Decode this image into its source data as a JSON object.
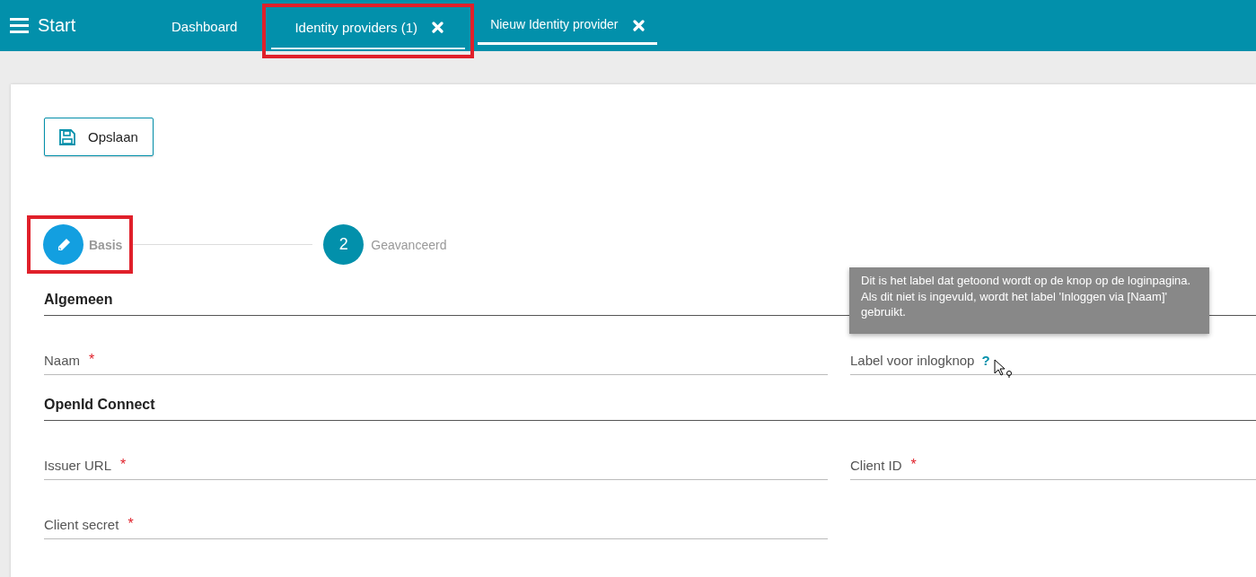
{
  "topbar": {
    "title": "Start"
  },
  "tabs": [
    {
      "label": "Dashboard",
      "selected": false,
      "closable": false,
      "highlighted": false,
      "hovered": false
    },
    {
      "label": "Identity providers (1)",
      "selected": false,
      "closable": true,
      "highlighted": true,
      "hovered": true
    },
    {
      "label": "Nieuw Identity provider",
      "selected": true,
      "closable": true,
      "highlighted": false,
      "hovered": false
    }
  ],
  "save_button": {
    "label": "Opslaan"
  },
  "steps": [
    {
      "label": "Basis",
      "selected": true,
      "highlighted": true
    },
    {
      "label": "Geavanceerd",
      "number": "2",
      "selected": false,
      "highlighted": false
    }
  ],
  "sections": [
    {
      "title": "Algemeen",
      "fields": [
        {
          "label": "Naam",
          "required_mark": "*"
        },
        {
          "label": "Label voor inlogknop",
          "help_mark": "?"
        }
      ]
    },
    {
      "title": "OpenId Connect",
      "fields": [
        {
          "label": "Issuer URL",
          "required_mark": "*"
        },
        {
          "label": "Client ID",
          "required_mark": "*"
        },
        {
          "label": "Client secret",
          "required_mark": "*"
        }
      ]
    }
  ],
  "tooltip": {
    "text": "Dit is het label dat getoond wordt op de knop op de loginpagina. Als dit niet is ingevuld, wordt het label 'Inloggen via [Naam]' gebruikt."
  }
}
